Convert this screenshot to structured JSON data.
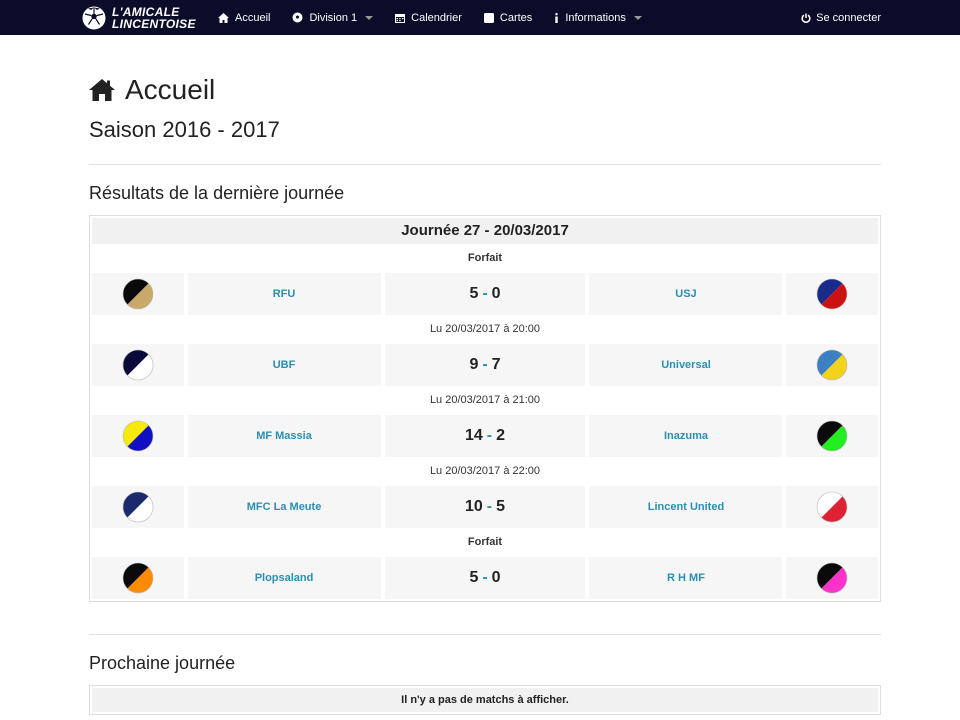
{
  "brand": {
    "line1": "L'AMICALE",
    "line2": "LINCENTOISE"
  },
  "nav": {
    "items": [
      {
        "label": "Accueil",
        "icon": "home-icon"
      },
      {
        "label": "Division 1",
        "icon": "soccer-ball-icon",
        "dropdown": true
      },
      {
        "label": "Calendrier",
        "icon": "calendar-icon"
      },
      {
        "label": "Cartes",
        "icon": "card-icon"
      },
      {
        "label": "Informations",
        "icon": "info-icon",
        "dropdown": true
      }
    ],
    "login": "Se connecter"
  },
  "page": {
    "title": "Accueil",
    "season": "Saison 2016 - 2017",
    "last_results_title": "Résultats de la dernière journée",
    "next_title": "Prochaine journée",
    "no_matches": "Il n'y a pas de matchs à afficher."
  },
  "journee": {
    "header": "Journée 27 - 20/03/2017",
    "matches": [
      {
        "info": "Forfait",
        "bold_info": true,
        "home": "RFU",
        "home_score": "5",
        "away_score": "0",
        "away": "USJ",
        "home_colors": [
          "#0a0a0a",
          "#c9a96a"
        ],
        "away_colors": [
          "#1a2b8c",
          "#cc1111"
        ]
      },
      {
        "info": "Lu 20/03/2017 à 20:00",
        "bold_info": false,
        "home": "UBF",
        "home_score": "9",
        "away_score": "7",
        "away": "Universal",
        "home_colors": [
          "#0b0b3a",
          "#ffffff"
        ],
        "away_colors": [
          "#3b7fc4",
          "#f2d21b"
        ]
      },
      {
        "info": "Lu 20/03/2017 à 21:00",
        "bold_info": false,
        "home": "MF Massia",
        "home_score": "14",
        "away_score": "2",
        "away": "Inazuma",
        "home_colors": [
          "#f5e90a",
          "#1010c0"
        ],
        "away_colors": [
          "#0a0a0a",
          "#22ee22"
        ]
      },
      {
        "info": "Lu 20/03/2017 à 22:00",
        "bold_info": false,
        "home": "MFC La Meute",
        "home_score": "10",
        "away_score": "5",
        "away": "Lincent United",
        "home_colors": [
          "#1a2a6c",
          "#ffffff"
        ],
        "away_colors": [
          "#ffffff",
          "#d23"
        ]
      },
      {
        "info": "Forfait",
        "bold_info": true,
        "home": "Plopsaland",
        "home_score": "5",
        "away_score": "0",
        "away": "R H MF",
        "home_colors": [
          "#0a0a0a",
          "#ff8c00"
        ],
        "away_colors": [
          "#0a0a0a",
          "#ff33cc"
        ]
      }
    ]
  },
  "colors": {
    "navbar": "#0b0b2a",
    "link": "#2a8fb0",
    "cell_bg": "#f6f6f6"
  }
}
